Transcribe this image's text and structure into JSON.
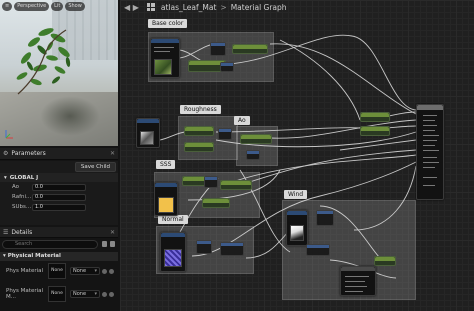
{
  "viewport": {
    "toolbar": [
      {
        "label": "Perspective"
      },
      {
        "label": "Lit"
      },
      {
        "label": "Show"
      }
    ]
  },
  "parameters_panel": {
    "title": "Parameters",
    "save_child_label": "Save Child",
    "group": "GLOBAL J",
    "rows": [
      {
        "name": "Ao",
        "value": "0.0"
      },
      {
        "name": "Rafni...",
        "value": "0.0"
      },
      {
        "name": "SUbs...",
        "value": "1.0"
      }
    ]
  },
  "details_panel": {
    "title": "Details",
    "search_placeholder": "Search",
    "section": "Physical Material",
    "rows": [
      {
        "label": "Phys Material",
        "thumb": "None",
        "combo": "None"
      },
      {
        "label": "Phys Material M...",
        "thumb": "None",
        "combo": "None"
      }
    ]
  },
  "graph": {
    "breadcrumb": {
      "asset": "atlas_Leaf_Mat",
      "separator": ">",
      "graph": "Material Graph"
    },
    "comments": [
      {
        "label": "Base color"
      },
      {
        "label": "Roughness"
      },
      {
        "label": "Ao"
      },
      {
        "label": "SSS"
      },
      {
        "label": "Normal"
      },
      {
        "label": "Wind"
      }
    ]
  },
  "colors": {
    "wire": "#d8d8d8",
    "comment_bg": "#5a5a5a",
    "node_bg": "#121212",
    "green_node": "#6d8f3a",
    "panel_bg": "#1a1a1a"
  }
}
